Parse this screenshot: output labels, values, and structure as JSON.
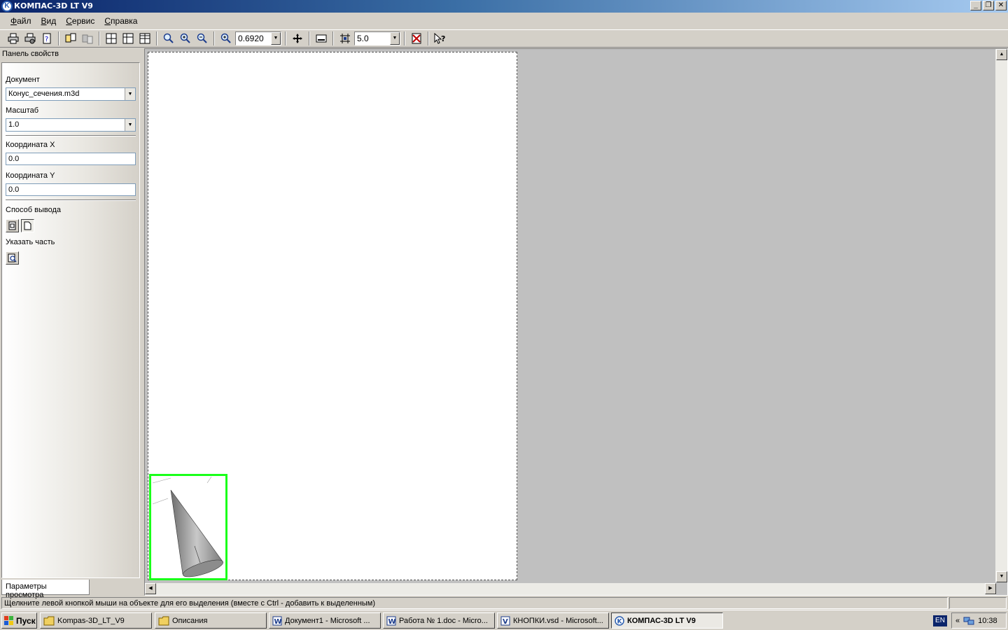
{
  "window": {
    "title": "КОМПАС-3D LT V9",
    "app_icon": "kompas-logo-icon"
  },
  "menu": [
    {
      "label": "Файл",
      "accel": "Ф",
      "rest": "айл"
    },
    {
      "label": "Вид",
      "accel": "В",
      "rest": "ид"
    },
    {
      "label": "Сервис",
      "accel": "С",
      "rest": "ервис"
    },
    {
      "label": "Справка",
      "accel": "С",
      "rest": "правка"
    }
  ],
  "toolbar": {
    "zoom_value": "0.6920",
    "step_value": "5.0"
  },
  "panel": {
    "title": "Панель свойств",
    "document_label": "Документ",
    "document_value": "Конус_сечения.m3d",
    "scale_label": "Масштаб",
    "scale_value": "1.0",
    "coord_x_label": "Координата X",
    "coord_x_value": "0.0",
    "coord_y_label": "Координата Y",
    "coord_y_value": "0.0",
    "output_label": "Способ вывода",
    "part_label": "Указать часть",
    "tab_label": "Параметры просмотра"
  },
  "status": {
    "text": "Щелкните левой кнопкой мыши на объекте для его выделения (вместе с Ctrl - добавить к выделенным)"
  },
  "taskbar": {
    "start_label": "Пуск",
    "tasks": [
      {
        "label": "Kompas-3D_LT_V9",
        "icon": "folder-icon"
      },
      {
        "label": "Описания",
        "icon": "folder-icon"
      },
      {
        "label": "Документ1 - Microsoft ...",
        "icon": "word-icon"
      },
      {
        "label": "Работа № 1.doc - Micro...",
        "icon": "word-icon"
      },
      {
        "label": "КНОПКИ.vsd - Microsoft...",
        "icon": "visio-icon"
      },
      {
        "label": "КОМПАС-3D LT V9",
        "icon": "kompas-icon"
      }
    ],
    "lang": "EN",
    "clock": "10:38"
  },
  "colors": {
    "preview_frame": "#1aff1a",
    "titlebar_start": "#0a246a"
  }
}
